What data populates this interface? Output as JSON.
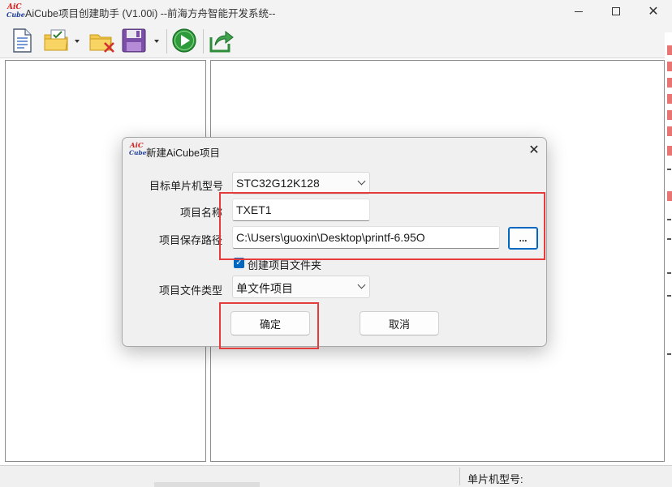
{
  "window": {
    "title": "AiCube项目创建助手 (V1.00i) --前海方舟智能开发系统--",
    "logo_top": "AiC",
    "logo_bottom": "Cube"
  },
  "toolbar": {
    "icons": [
      "new-file-icon",
      "open-project-icon",
      "delete-project-icon",
      "save-icon",
      "run-icon",
      "export-icon"
    ]
  },
  "statusbar": {
    "mcu_model_label": "单片机型号:"
  },
  "dialog": {
    "title": "新建AiCube项目",
    "logo_top": "AiC",
    "logo_bottom": "Cube",
    "mcu_label": "目标单片机型号",
    "mcu_value": "STC32G12K128",
    "name_label": "项目名称",
    "name_value": "TXET1",
    "path_label": "项目保存路径",
    "path_value": "C:\\Users\\guoxin\\Desktop\\printf-6.95O",
    "browse_label": "...",
    "create_folder_label": "创建项目文件夹",
    "create_folder_checked": true,
    "file_type_label": "项目文件类型",
    "file_type_value": "单文件项目",
    "ok_label": "确定",
    "cancel_label": "取消"
  },
  "colors": {
    "accent": "#0067c0",
    "annotation": "#e53b3b"
  }
}
